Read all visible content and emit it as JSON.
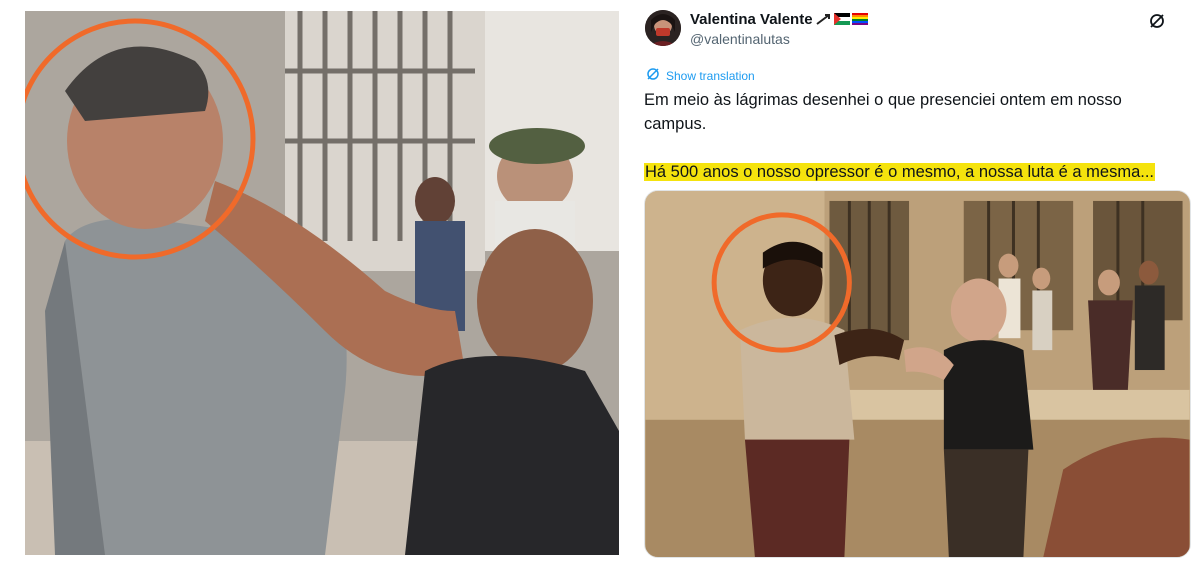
{
  "tweet": {
    "author_name": "Valentina Valente",
    "author_badges": [
      "arrow-emoji",
      "palestine-flag",
      "rainbow-flag"
    ],
    "handle": "@valentinalutas",
    "show_translation": "Show translation",
    "text_line1": "Em meio às lágrimas desenhei o que presenciei ontem em nosso campus.",
    "text_line2": "Há 500 anos o nosso opressor é o mesmo, a nossa luta é a mesma..."
  },
  "colors": {
    "highlight": "#f5e30d",
    "circle": "#f06a2a",
    "link": "#1d9bf0"
  }
}
